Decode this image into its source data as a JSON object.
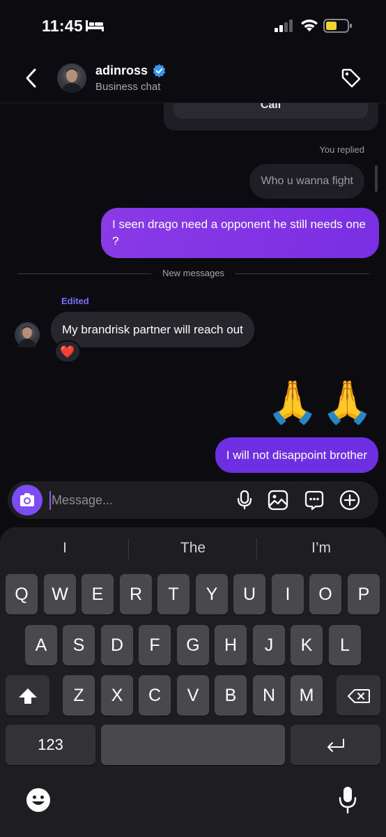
{
  "status": {
    "time": "11:45"
  },
  "header": {
    "username": "adinross",
    "subtitle": "Business chat",
    "back": "back",
    "tag": "tag"
  },
  "chat": {
    "call_label": "Call",
    "you_replied": "You replied",
    "replied_to": "Who u wanna fight",
    "out_msg_1": "I seen drago need a opponent he still needs one ?",
    "new_messages": "New messages",
    "edited": "Edited",
    "in_msg": "My brandrisk partner will reach out",
    "reaction": "❤️",
    "emoji_msg": "🙏🙏",
    "out_msg_2": "I will not disappoint brother"
  },
  "composer": {
    "placeholder": "Message..."
  },
  "keyboard": {
    "suggestions": [
      "I",
      "The",
      "I’m"
    ],
    "row1": [
      "Q",
      "W",
      "E",
      "R",
      "T",
      "Y",
      "U",
      "I",
      "O",
      "P"
    ],
    "row2": [
      "A",
      "S",
      "D",
      "F",
      "G",
      "H",
      "J",
      "K",
      "L"
    ],
    "row3": [
      "Z",
      "X",
      "C",
      "V",
      "B",
      "N",
      "M"
    ],
    "numbers_key": "123"
  },
  "colors": {
    "accent": "#7d32e6",
    "background": "#0c0c10",
    "incoming_bubble": "#26262c",
    "edited_label": "#7a6ff6"
  }
}
